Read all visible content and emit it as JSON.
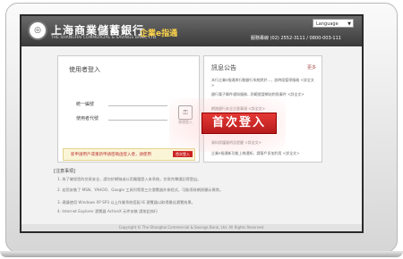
{
  "header": {
    "bank_name": "上海商業儲蓄銀行",
    "bank_name_en": "THE SHANGHAI COMMERCIAL & SAVINGS BANK, LTD.",
    "slogan": "企業e指通",
    "language": "Language",
    "hotline": "服務專線 (02) 2552-3111 / 0800-003-111"
  },
  "login": {
    "title": "使用者登入",
    "fields": [
      {
        "label": "統一編號"
      },
      {
        "label": "使用者代號"
      }
    ],
    "side_link": "憑證登入",
    "notice_text": "新申請用戶或重新申請密碼函登入者，請使用",
    "notice_button": "首次登入"
  },
  "announcement": {
    "title": "訊息公告",
    "more": "更多",
    "items": [
      "本行企業e指通與行動銀行系統將於...，該時段暫停服務 <詳全文>",
      "銀行電子郵件通知服務...防範假冒網站釣魚事件 <詳全文>",
      "網路銀行安全注意事項 <詳全文>",
      "資料保護聲明及提醒 <詳全文>",
      "企業e指通新功能上線通知，請客戶多加利用 <詳全文>"
    ]
  },
  "first_login_banner": "首次登入",
  "notes": {
    "title": "[注意事項]",
    "items": [
      "1. 為了確保您的交易安全，請勿於網咖或公用電腦登入本系統，交易完畢請記得登出。",
      "2. 若您安裝了 MSN、YAHOO、Google 工具列等第三方瀏覽器外掛程式，可能導致網頁顯示異常。",
      "3. 建議使用 Windows XP SP3 以上作業系統搭配 IE 瀏覽器以取得最佳瀏覽效果。",
      "4. Internet Explorer 瀏覽器 ActiveX 元件安裝 請按此執行"
    ]
  },
  "footer": "Copyright © The Shanghai Commercial & Savings Bank, Ltd. All Rights Reserved."
}
